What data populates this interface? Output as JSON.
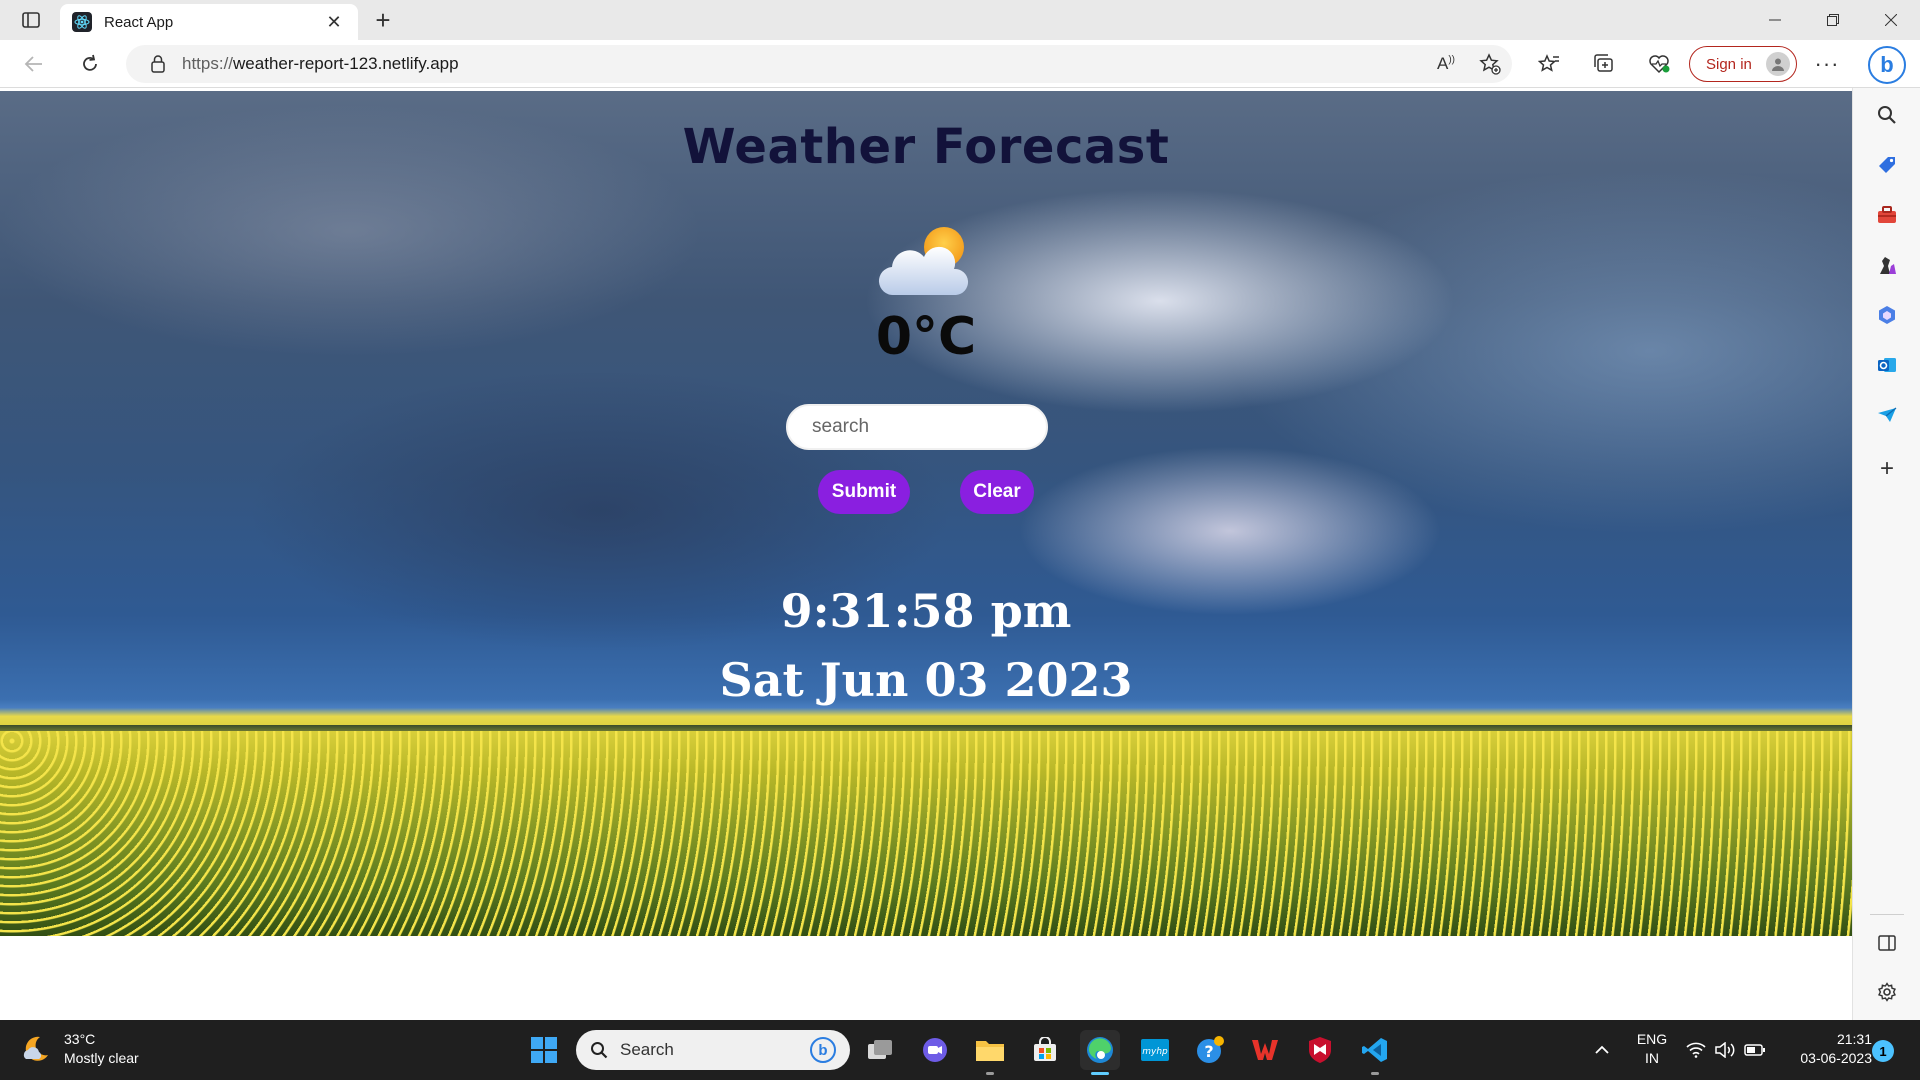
{
  "browser": {
    "tab": {
      "title": "React App"
    },
    "url": {
      "protocol": "https://",
      "host": "weather-report-123.netlify.app"
    },
    "signin_label": "Sign in"
  },
  "app": {
    "title": "Weather Forecast",
    "temperature": "0°C",
    "weather_icon": "partly-cloudy-icon",
    "search_placeholder": "search",
    "submit_label": "Submit",
    "clear_label": "Clear",
    "time": "9:31:58 pm",
    "date": "Sat Jun 03 2023",
    "button_color": "#8a1fe0"
  },
  "taskbar": {
    "weather_temp": "33°C",
    "weather_desc": "Mostly clear",
    "search_label": "Search",
    "lang_line1": "ENG",
    "lang_line2": "IN",
    "clock_time": "21:31",
    "clock_date": "03-06-2023",
    "notification_count": "1",
    "pinned_apps": [
      "start",
      "search",
      "task-view",
      "teams-chat",
      "file-explorer",
      "microsoft-store",
      "edge",
      "myhp",
      "get-help",
      "wps-office",
      "mcafee",
      "vscode"
    ]
  }
}
